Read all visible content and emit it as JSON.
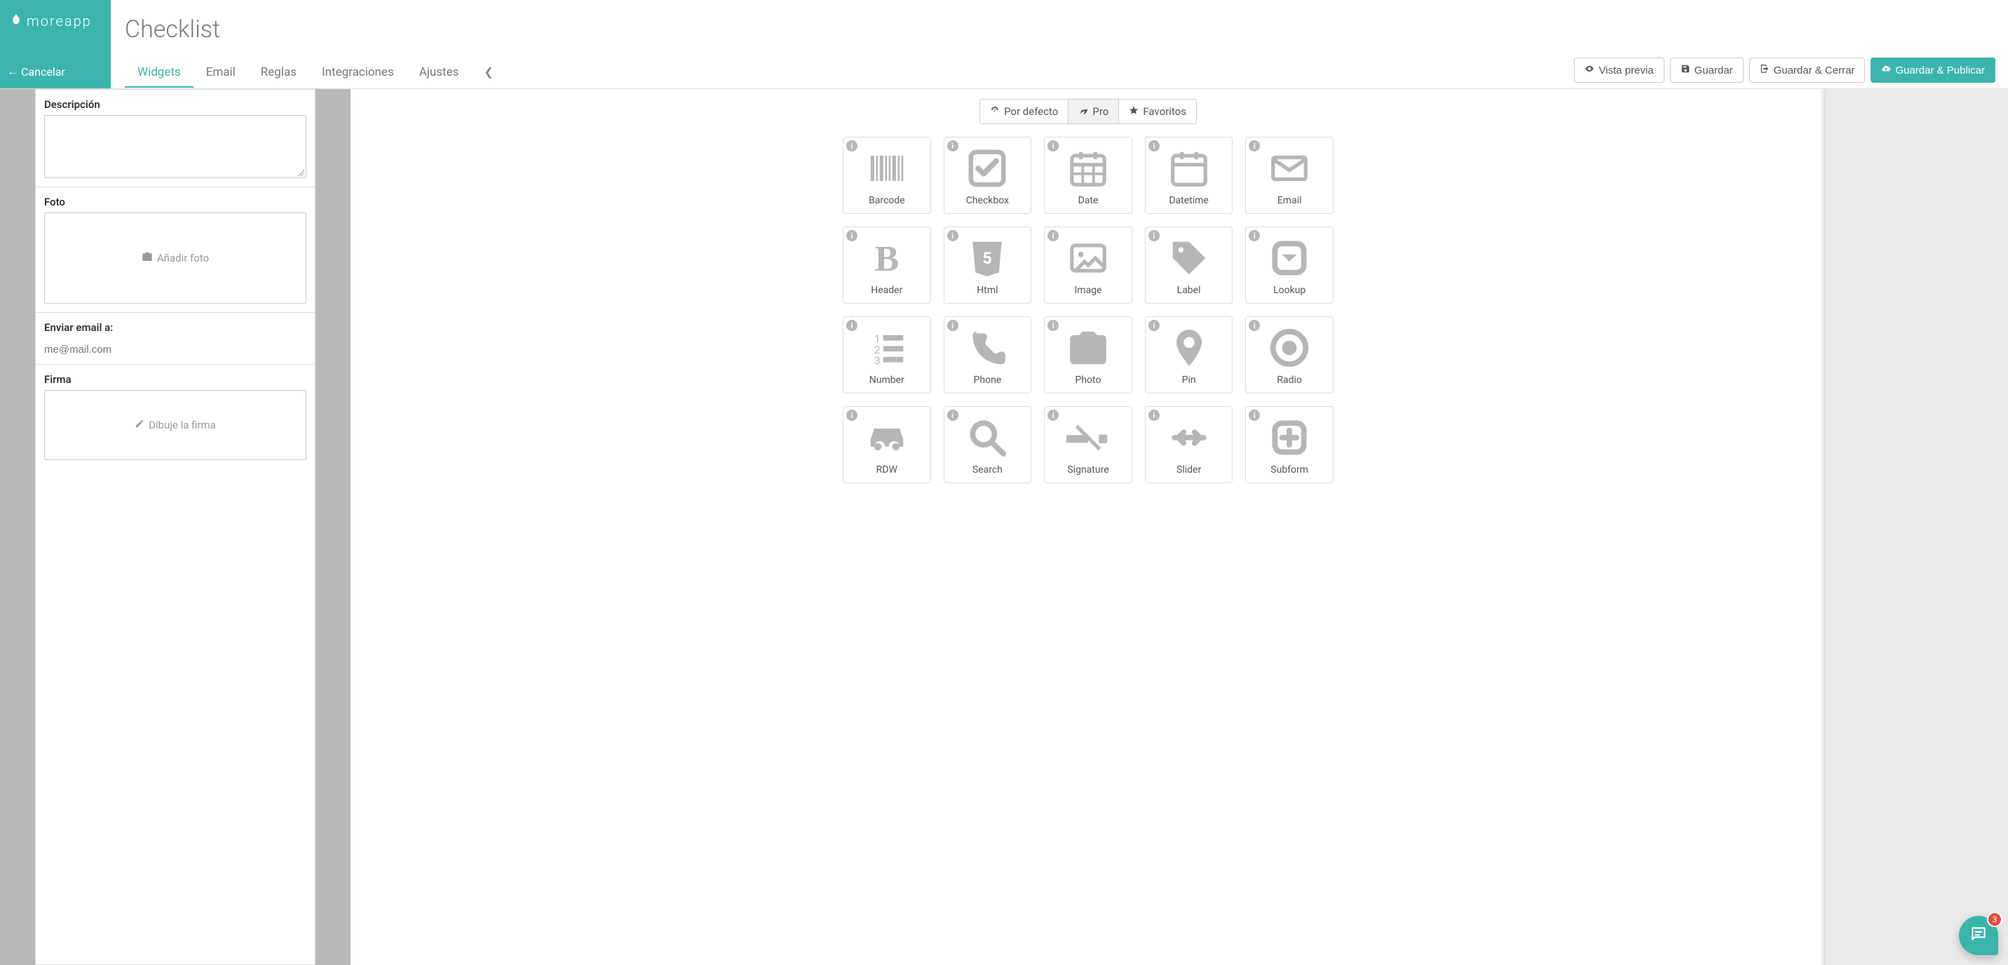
{
  "brand": {
    "name": "moreapp"
  },
  "header": {
    "cancel": "Cancelar",
    "title": "Checklist",
    "tabs": [
      {
        "label": "Widgets",
        "active": true
      },
      {
        "label": "Email"
      },
      {
        "label": "Reglas"
      },
      {
        "label": "Integraciones"
      },
      {
        "label": "Ajustes"
      }
    ],
    "actions": {
      "preview": "Vista previa",
      "save": "Guardar",
      "save_close": "Guardar & Cerrar",
      "save_publish": "Guardar & Publicar"
    }
  },
  "form_fields": {
    "descripcion_label": "Descripción",
    "foto_label": "Foto",
    "foto_placeholder": "Añadir foto",
    "email_label": "Enviar email a:",
    "email_placeholder": "me@mail.com",
    "firma_label": "Firma",
    "firma_placeholder": "Dibuje la firma"
  },
  "gallery": {
    "tabs": {
      "default": "Por defecto",
      "pro": "Pro",
      "favorites": "Favoritos",
      "active": "pro"
    },
    "widgets": [
      {
        "label": "Barcode",
        "icon": "barcode"
      },
      {
        "label": "Checkbox",
        "icon": "checkbox"
      },
      {
        "label": "Date",
        "icon": "date"
      },
      {
        "label": "Datetime",
        "icon": "datetime"
      },
      {
        "label": "Email",
        "icon": "email"
      },
      {
        "label": "Header",
        "icon": "header"
      },
      {
        "label": "Html",
        "icon": "html"
      },
      {
        "label": "Image",
        "icon": "image"
      },
      {
        "label": "Label",
        "icon": "label"
      },
      {
        "label": "Lookup",
        "icon": "lookup"
      },
      {
        "label": "Number",
        "icon": "number"
      },
      {
        "label": "Phone",
        "icon": "phone"
      },
      {
        "label": "Photo",
        "icon": "photo"
      },
      {
        "label": "Pin",
        "icon": "pin"
      },
      {
        "label": "Radio",
        "icon": "radio"
      },
      {
        "label": "RDW",
        "icon": "rdw"
      },
      {
        "label": "Search",
        "icon": "search"
      },
      {
        "label": "Signature",
        "icon": "signature"
      },
      {
        "label": "Slider",
        "icon": "slider"
      },
      {
        "label": "Subform",
        "icon": "subform"
      }
    ]
  },
  "chat": {
    "badge": "3"
  }
}
